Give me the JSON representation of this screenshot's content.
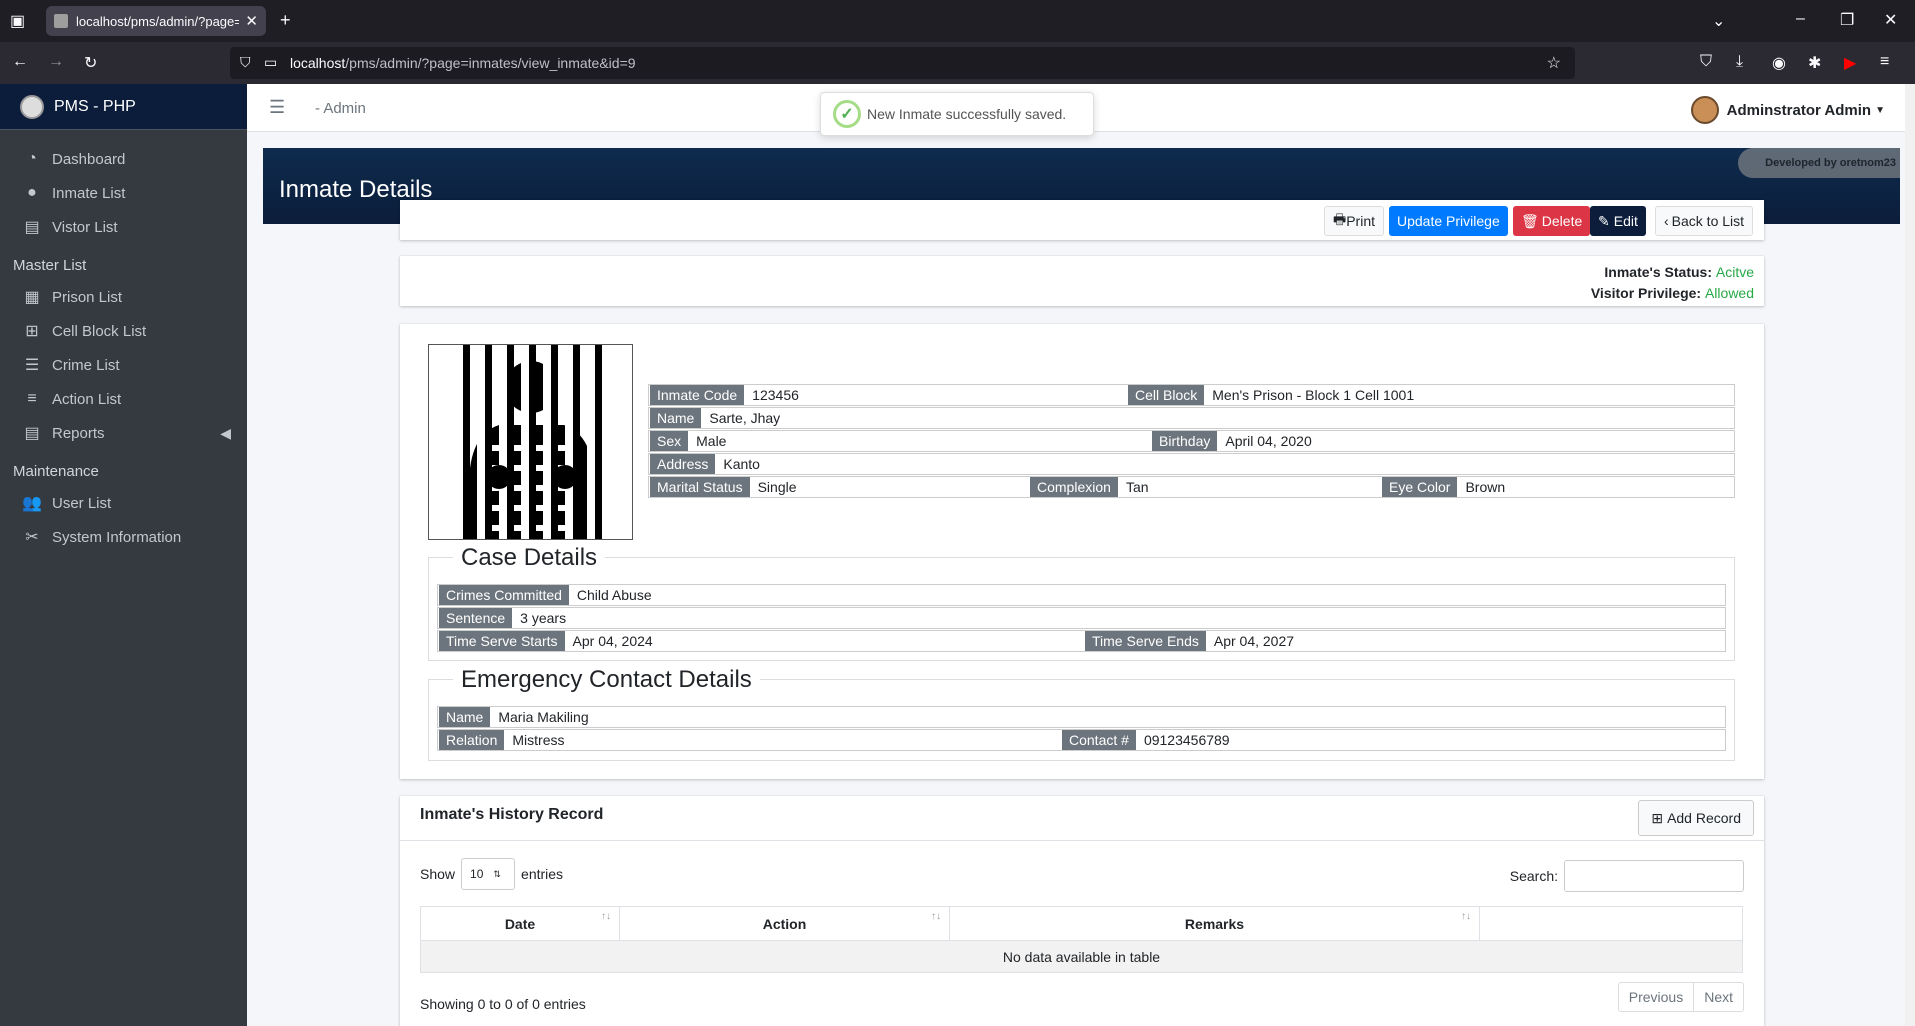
{
  "browser": {
    "tab_title": "localhost/pms/admin/?page=in",
    "url_host": "localhost",
    "url_path": "/pms/admin/?page=inmates/view_inmate&id=9"
  },
  "sidebar": {
    "brand": "PMS - PHP",
    "items": [
      {
        "label": "Dashboard",
        "icon": "dashboard-icon"
      },
      {
        "label": "Inmate List",
        "icon": "user-icon"
      },
      {
        "label": "Vistor List",
        "icon": "file-icon"
      }
    ],
    "master_header": "Master List",
    "master_items": [
      {
        "label": "Prison List",
        "icon": "table-icon"
      },
      {
        "label": "Cell Block List",
        "icon": "grid-icon"
      },
      {
        "label": "Crime List",
        "icon": "list-icon"
      },
      {
        "label": "Action List",
        "icon": "bars-icon"
      },
      {
        "label": "Reports",
        "icon": "file-icon"
      }
    ],
    "maintenance_header": "Maintenance",
    "maintenance_items": [
      {
        "label": "User List",
        "icon": "users-icon"
      },
      {
        "label": "System Information",
        "icon": "tools-icon"
      }
    ]
  },
  "topbar": {
    "admin_label": "- Admin",
    "user_name": "Adminstrator Admin"
  },
  "toast": {
    "message": "New Inmate successfully saved."
  },
  "page": {
    "title": "Inmate Details",
    "developed_by": "Developed by oretnom23"
  },
  "buttons": {
    "print": "Print",
    "update_privilege": "Update Privilege",
    "delete": "Delete",
    "edit": "Edit",
    "back": "Back to List"
  },
  "status": {
    "status_label": "Inmate's Status:",
    "status_value": "Acitve",
    "privilege_label": "Visitor Privilege:",
    "privilege_value": "Allowed"
  },
  "inmate": {
    "code_label": "Inmate Code",
    "code": "123456",
    "cell_label": "Cell Block",
    "cell": "Men's Prison - Block 1 Cell 1001",
    "name_label": "Name",
    "name": "Sarte, Jhay",
    "sex_label": "Sex",
    "sex": "Male",
    "birthday_label": "Birthday",
    "birthday": "April 04, 2020",
    "address_label": "Address",
    "address": "Kanto",
    "marital_label": "Marital Status",
    "marital": "Single",
    "complexion_label": "Complexion",
    "complexion": "Tan",
    "eye_label": "Eye Color",
    "eye": "Brown"
  },
  "case": {
    "legend": "Case Details",
    "crimes_label": "Crimes Committed",
    "crimes": "Child Abuse",
    "sentence_label": "Sentence",
    "sentence": "3 years",
    "start_label": "Time Serve Starts",
    "start": "Apr 04, 2024",
    "end_label": "Time Serve Ends",
    "end": "Apr 04, 2027"
  },
  "emergency": {
    "legend": "Emergency Contact Details",
    "name_label": "Name",
    "name": "Maria Makiling",
    "relation_label": "Relation",
    "relation": "Mistress",
    "contact_label": "Contact #",
    "contact": "09123456789"
  },
  "history": {
    "title": "Inmate's History Record",
    "add_button": "Add Record",
    "show": "Show",
    "entries_value": "10",
    "entries": "entries",
    "search_label": "Search:",
    "columns": [
      "Date",
      "Action",
      "Remarks"
    ],
    "empty": "No data available in table",
    "showing": "Showing 0 to 0 of 0 entries",
    "previous": "Previous",
    "next": "Next"
  }
}
